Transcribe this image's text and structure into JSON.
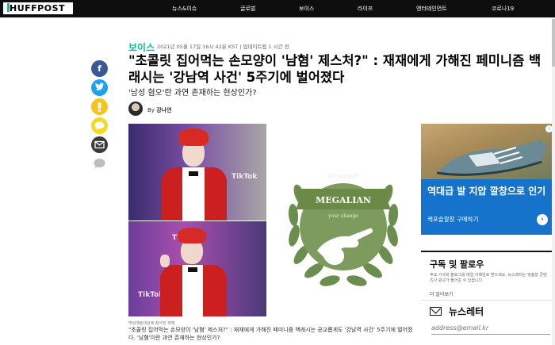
{
  "header": {
    "logo": "HUFFPOST",
    "nav": [
      "뉴스&이슈",
      "글로벌",
      "보이스",
      "라이프",
      "엔터테인먼트",
      "코로나19"
    ]
  },
  "share": {
    "icons": [
      "facebook-icon",
      "twitter-icon",
      "kakaostory-icon",
      "kakaotalk-icon",
      "email-icon",
      "comment-icon"
    ],
    "colors": {
      "facebook": "#3b5998",
      "twitter": "#1da1f2",
      "kakaostory": "#f5c518",
      "kakaotalk": "#f9d71c",
      "email": "#3a3a3a",
      "comment": "#bdbdbd"
    }
  },
  "article": {
    "section": "보이스",
    "meta": "2021년 05월 17일 16시 42분 KST | 업데이트됨 1 시간 전",
    "headline": "\"초콜릿 집어먹는 손모양이 '남혐' 제스처?\" : 재재에게 가해진 페미니즘 백래시는 '강남역 사건' 5주기에 벌어졌다",
    "subhead": "'남성 혐오'란 과연 존재하는 현상인가?",
    "byline_prefix": "By",
    "author": "강나연",
    "photo_caption": "백상예술대상에 참석한 재재",
    "caption": "\"초콜릿 집어먹는 손모양이 '남혐' 제스처?\" : 재재에게 가해진 페미니즘 백래시는 공교롭게도 '강남역 사건' 5주기에 벌어졌다. '남혐'이란 과연 존재하는 현상인가?",
    "tiktok_text": "TikTok",
    "emblem": {
      "top_text": "We support",
      "banner": "MEGALIAN",
      "bottom_text": "your change"
    }
  },
  "sidebar": {
    "ad": {
      "title": "역대급 발 지압 깔창으로 인기",
      "subtitle": "케포슬깔창 구매하기",
      "arrow": "›",
      "badge": "i"
    },
    "follow": {
      "title": "구독 및 팔로우",
      "text": "주요 기사와 블로그를 매일 이메일로 받으세요. 뉴스레터는 맞춤형 콘텐츠나 광고가 들어갈 수 있습니다.",
      "more": "더 알아보기"
    },
    "newsletter": {
      "title": "뉴스레터",
      "placeholder": "address@email.kr"
    }
  },
  "colors": {
    "accent": "#0dbe98",
    "topbar": "#0e0e0e",
    "ad_blue": "#1673cc",
    "emblem_green": "#6b8e4e"
  }
}
